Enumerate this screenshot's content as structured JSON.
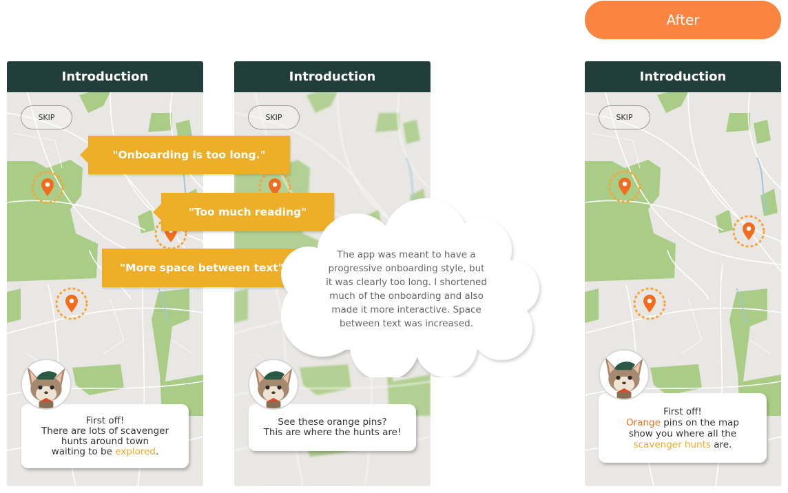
{
  "after_label": "After",
  "screens": [
    {
      "title": "Introduction",
      "skip": "SKIP",
      "speech_lines": [
        "First off!",
        "There are lots of scavenger",
        "hunts around town"
      ],
      "speech_last_prefix": "waiting to be ",
      "speech_last_highlight": "explored",
      "speech_last_suffix": "."
    },
    {
      "title": "Introduction",
      "skip": "SKIP",
      "speech_lines": [
        "See these orange pins?",
        "This are where the hunts are!"
      ]
    },
    {
      "title": "Introduction",
      "skip": "SKIP",
      "speech_line1": "First off!",
      "speech_line2_highlight": "Orange",
      "speech_line2_rest": " pins on the map",
      "speech_line3": "show you where all the",
      "speech_line4_highlight": "scavenger hunts",
      "speech_line4_rest": " are."
    }
  ],
  "feedback": [
    "\"Onboarding is too long.\"",
    "\"Too much reading\"",
    "\"More space between text\""
  ],
  "cloud_text": "The app was meant to have a progressive onboarding style, but it was clearly too long. I shortened much of the onboarding and also made it more interactive. Space between text was increased.",
  "colors": {
    "header": "#213e3b",
    "after_pill": "#fb8440",
    "callout": "#efae28",
    "pin": "#f26c1f",
    "pin_ring": "#f7a43a",
    "park": "#a9cd86",
    "map": "#e9e7e3"
  },
  "icons": [
    "map-pin-icon",
    "mascot-avatar-icon",
    "cloud-shape"
  ]
}
